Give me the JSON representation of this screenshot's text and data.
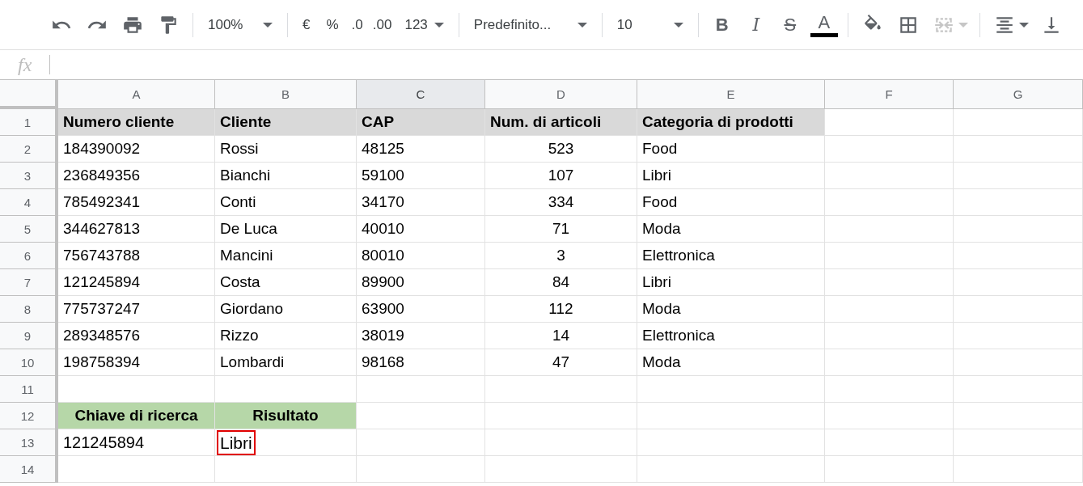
{
  "toolbar": {
    "zoom": "100%",
    "currency": "€",
    "percent": "%",
    "decrease_decimals": ".0",
    "increase_decimals": ".00",
    "number_format": "123",
    "font": "Predefinito...",
    "font_size": "10",
    "bold": "B",
    "italic": "I",
    "strikethrough": "S",
    "text_color": "A",
    "merge_disabled": true
  },
  "formula_bar": {
    "label": "fx"
  },
  "columns": [
    {
      "label": "A",
      "selected": false
    },
    {
      "label": "B",
      "selected": false
    },
    {
      "label": "C",
      "selected": true
    },
    {
      "label": "D",
      "selected": false
    },
    {
      "label": "E",
      "selected": false
    },
    {
      "label": "F",
      "selected": false
    },
    {
      "label": "G",
      "selected": false
    }
  ],
  "rows": [
    {
      "number": "1",
      "cells": [
        {
          "text": "Numero cliente",
          "kind": "header"
        },
        {
          "text": "Cliente",
          "kind": "header"
        },
        {
          "text": "CAP",
          "kind": "header"
        },
        {
          "text": "Num. di articoli",
          "kind": "header"
        },
        {
          "text": "Categoria di prodotti",
          "kind": "header"
        }
      ]
    },
    {
      "number": "2",
      "cells": [
        {
          "text": "184390092",
          "kind": "text"
        },
        {
          "text": "Rossi",
          "kind": "text"
        },
        {
          "text": "48125",
          "kind": "text"
        },
        {
          "text": "523",
          "kind": "centered"
        },
        {
          "text": "Food",
          "kind": "text"
        }
      ]
    },
    {
      "number": "3",
      "cells": [
        {
          "text": "236849356",
          "kind": "text"
        },
        {
          "text": "Bianchi",
          "kind": "text"
        },
        {
          "text": "59100",
          "kind": "text"
        },
        {
          "text": "107",
          "kind": "centered"
        },
        {
          "text": "Libri",
          "kind": "text"
        }
      ]
    },
    {
      "number": "4",
      "cells": [
        {
          "text": "785492341",
          "kind": "text"
        },
        {
          "text": "Conti",
          "kind": "text"
        },
        {
          "text": "34170",
          "kind": "text"
        },
        {
          "text": "334",
          "kind": "centered"
        },
        {
          "text": "Food",
          "kind": "text"
        }
      ]
    },
    {
      "number": "5",
      "cells": [
        {
          "text": "344627813",
          "kind": "text"
        },
        {
          "text": "De Luca",
          "kind": "text"
        },
        {
          "text": "40010",
          "kind": "text"
        },
        {
          "text": "71",
          "kind": "centered"
        },
        {
          "text": "Moda",
          "kind": "text"
        }
      ]
    },
    {
      "number": "6",
      "cells": [
        {
          "text": "756743788",
          "kind": "text"
        },
        {
          "text": "Mancini",
          "kind": "text"
        },
        {
          "text": "80010",
          "kind": "text"
        },
        {
          "text": "3",
          "kind": "centered"
        },
        {
          "text": "Elettronica",
          "kind": "text"
        }
      ]
    },
    {
      "number": "7",
      "cells": [
        {
          "text": "121245894",
          "kind": "text"
        },
        {
          "text": "Costa",
          "kind": "text"
        },
        {
          "text": "89900",
          "kind": "text"
        },
        {
          "text": "84",
          "kind": "centered"
        },
        {
          "text": "Libri",
          "kind": "text"
        }
      ]
    },
    {
      "number": "8",
      "cells": [
        {
          "text": "775737247",
          "kind": "text"
        },
        {
          "text": "Giordano",
          "kind": "text"
        },
        {
          "text": "63900",
          "kind": "text"
        },
        {
          "text": "112",
          "kind": "centered"
        },
        {
          "text": "Moda",
          "kind": "text"
        }
      ]
    },
    {
      "number": "9",
      "cells": [
        {
          "text": "289348576",
          "kind": "text"
        },
        {
          "text": "Rizzo",
          "kind": "text"
        },
        {
          "text": "38019",
          "kind": "text"
        },
        {
          "text": "14",
          "kind": "centered"
        },
        {
          "text": "Elettronica",
          "kind": "text"
        }
      ]
    },
    {
      "number": "10",
      "cells": [
        {
          "text": "198758394",
          "kind": "text"
        },
        {
          "text": "Lombardi",
          "kind": "text"
        },
        {
          "text": "98168",
          "kind": "text"
        },
        {
          "text": "47",
          "kind": "centered"
        },
        {
          "text": "Moda",
          "kind": "text"
        }
      ]
    },
    {
      "number": "11",
      "cells": []
    },
    {
      "number": "12",
      "cells": [
        {
          "text": "Chiave di ricerca",
          "kind": "lookup-header"
        },
        {
          "text": "Risultato",
          "kind": "lookup-header"
        }
      ]
    },
    {
      "number": "13",
      "cells": [
        {
          "text": "121245894",
          "kind": "large"
        },
        {
          "text": "Libri",
          "kind": "result"
        }
      ]
    },
    {
      "number": "14",
      "cells": []
    }
  ]
}
